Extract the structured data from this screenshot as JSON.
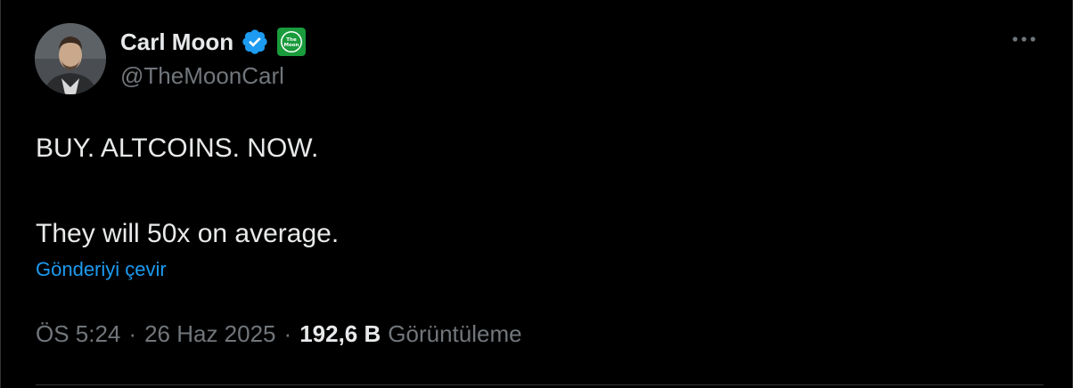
{
  "author": {
    "display_name": "Carl Moon",
    "handle": "@TheMoonCarl",
    "verified_icon": "verified-badge-icon",
    "affiliate_badge": "the-moon-affiliate-badge",
    "affiliate_badge_text": "The Moon",
    "avatar": "avatar-photo"
  },
  "tweet": {
    "text": "BUY. ALTCOINS. NOW.\n\nThey will 50x on average.",
    "translate_label": "Gönderiyi çevir",
    "time": "ÖS 5:24",
    "separator": "·",
    "date": "26 Haz 2025",
    "views_count": "192,6 B",
    "views_label": "Görüntüleme"
  },
  "colors": {
    "background": "#000000",
    "text_primary": "#e7e9ea",
    "text_secondary": "#71767b",
    "link": "#1d9bf0",
    "verified": "#1d9bf0",
    "affiliate_green": "#1a9b3c",
    "divider": "#2f3336"
  },
  "icons": {
    "more": "more-options-icon"
  }
}
